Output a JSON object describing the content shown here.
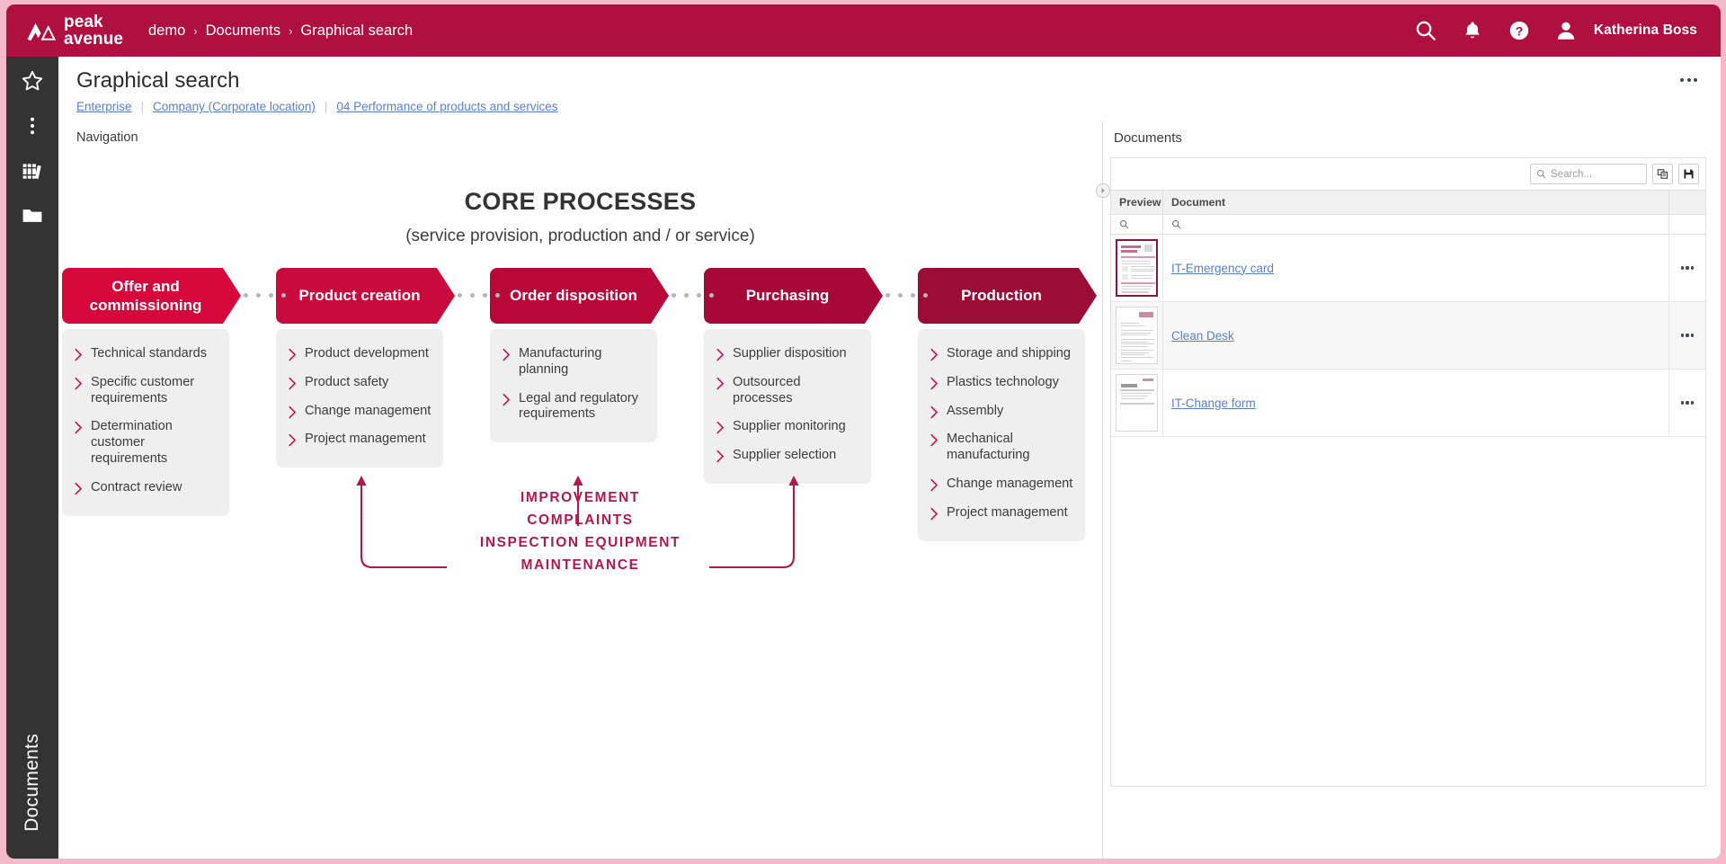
{
  "topbar": {
    "brand_line1": "peak",
    "brand_line2": "avenue",
    "breadcrumbs": [
      "demo",
      "Documents",
      "Graphical search"
    ],
    "separator": "›",
    "icons": [
      "search-icon",
      "bell-icon",
      "help-icon",
      "user-icon"
    ],
    "username": "Katherina Boss",
    "bg_color": "#b0103f"
  },
  "rail": {
    "icons": [
      "star-icon",
      "more-vertical-icon",
      "library-icon",
      "folder-icon"
    ],
    "vertical_label": "Documents",
    "bg_color": "#333333"
  },
  "page": {
    "title": "Graphical search",
    "subcrumbs": [
      "Enterprise",
      "Company (Corporate location)",
      "04 Performance of products and services"
    ],
    "nav_label": "Navigation",
    "overflow_menu": "page-overflow-menu"
  },
  "diagram": {
    "title": "CORE PROCESSES",
    "subtitle": "(service provision, production and / or service)",
    "columns": [
      {
        "title": "Offer and commissioning",
        "color": "#d6083b",
        "items": [
          "Technical standards",
          "Specific customer requirements",
          "Determination customer requirements",
          "Contract review"
        ]
      },
      {
        "title": "Product creation",
        "color": "#c80a3c",
        "items": [
          "Product development",
          "Product safety",
          "Change management",
          "Project management"
        ]
      },
      {
        "title": "Order disposition",
        "color": "#b8083a",
        "items": [
          "Manufacturing planning",
          "Legal and regulatory requirements"
        ]
      },
      {
        "title": "Purchasing",
        "color": "#a80839",
        "items": [
          "Supplier disposition",
          "Outsourced processes",
          "Supplier monitoring",
          "Supplier selection"
        ]
      },
      {
        "title": "Production",
        "color": "#9b0d36",
        "items": [
          "Storage and shipping",
          "Plastics technology",
          "Assembly",
          "Mechanical manufacturing",
          "Change management",
          "Project management"
        ]
      }
    ],
    "loop_lines": [
      "IMPROVEMENT",
      "COMPLAINTS",
      "INSPECTION EQUIPMENT",
      "MAINTENANCE"
    ],
    "loop_color": "#b0194b",
    "panel_bg": "#efefef",
    "connector_dot_color": "#b6b6b6"
  },
  "documents": {
    "title": "Documents",
    "search_placeholder": "Search...",
    "search_value": "",
    "toolbar_buttons": [
      "copy-icon",
      "save-icon"
    ],
    "columns": [
      "Preview",
      "Document"
    ],
    "rows": [
      {
        "name": "IT-Emergency card",
        "selected": true
      },
      {
        "name": "Clean Desk",
        "selected": false
      },
      {
        "name": "IT-Change form",
        "selected": false
      }
    ],
    "row_menu": "row-overflow-menu",
    "link_color": "#5b7fc7",
    "selected_border": "#8e1538"
  }
}
